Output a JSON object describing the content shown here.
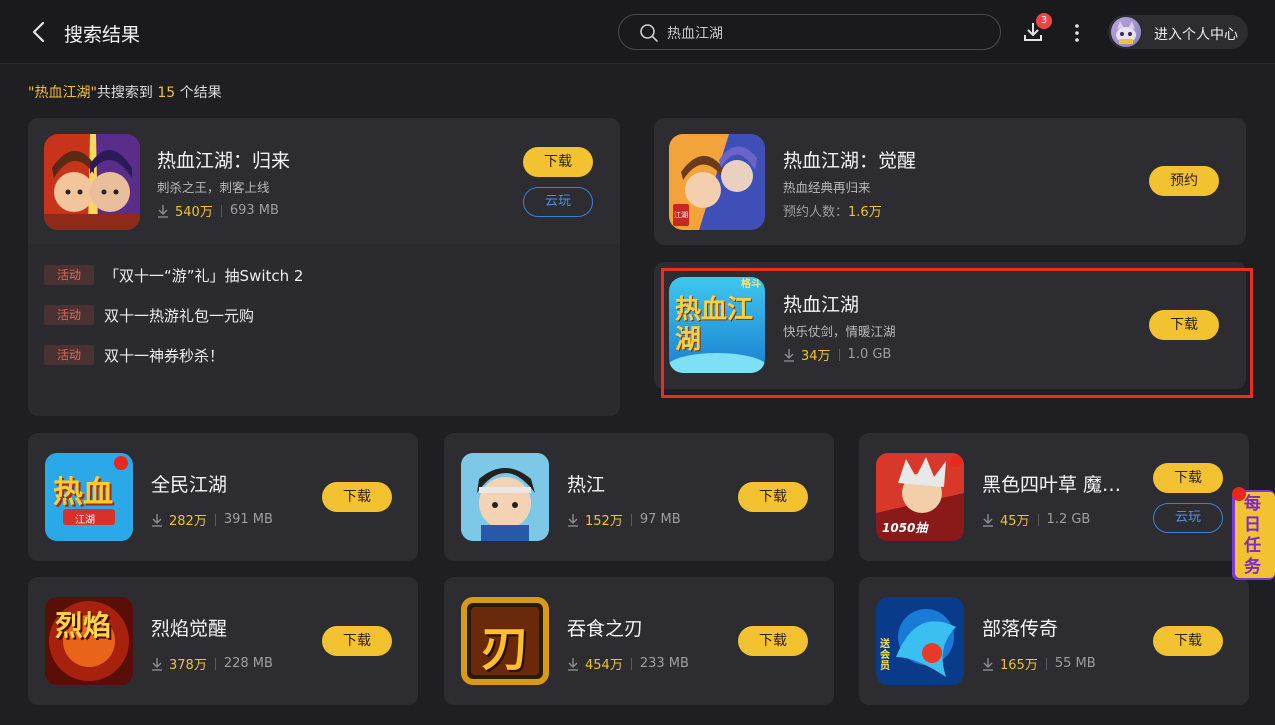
{
  "header": {
    "title": "搜索结果",
    "search_text": "热血江湖",
    "download_badge": "3",
    "profile_label": "进入个人中心"
  },
  "summary": {
    "quote_open": "\"",
    "keyword": "热血江湖",
    "quote_close": "\"",
    "prefix": "共搜索到",
    "count": "15",
    "suffix": "个结果"
  },
  "featured": {
    "name": "热血江湖：归来",
    "desc": "刺杀之王，刺客上线",
    "downloads": "540万",
    "size": "693 MB",
    "download_label": "下载",
    "cloud_label": "云玩",
    "activities": [
      {
        "tag": "活动",
        "text": "「双十一“游”礼」抽Switch 2"
      },
      {
        "tag": "活动",
        "text": "双十一热游礼包一元购"
      },
      {
        "tag": "活动",
        "text": "双十一神券秒杀！"
      }
    ]
  },
  "right_cards": [
    {
      "name": "热血江湖：觉醒",
      "desc": "热血经典再归来",
      "meta_label": "预约人数：",
      "meta_value": "1.6万",
      "button": "预约"
    },
    {
      "name": "热血江湖",
      "desc": "快乐仗剑，情暖江湖",
      "downloads": "34万",
      "size": "1.0 GB",
      "button": "下载"
    }
  ],
  "grid": [
    {
      "name": "全民江湖",
      "downloads": "282万",
      "size": "391 MB",
      "button": "下载"
    },
    {
      "name": "热江",
      "downloads": "152万",
      "size": "97 MB",
      "button": "下载"
    },
    {
      "name": "黑色四叶草 魔…",
      "downloads": "45万",
      "size": "1.2 GB",
      "button": "下载",
      "cloud": "云玩"
    },
    {
      "name": "烈焰觉醒",
      "downloads": "378万",
      "size": "228 MB",
      "button": "下载"
    },
    {
      "name": "吞食之刃",
      "downloads": "454万",
      "size": "233 MB",
      "button": "下载"
    },
    {
      "name": "部落传奇",
      "downloads": "165万",
      "size": "55 MB",
      "button": "下载"
    }
  ],
  "icon_text": {
    "rxjh_main": "热血江湖",
    "rxjh_tag": "格斗",
    "awaken_tag": "江湖",
    "quanmin_big": "热血",
    "quanmin_small": "江湖",
    "clover_label": "1050抽",
    "lieyan": "烈焰",
    "blade": "刃",
    "tribe_tag": "送会员"
  },
  "daily_task": "每日任务",
  "colors": {
    "accent": "#f2c230",
    "cloud_blue": "#3d7fd8",
    "highlight_red": "#e8311c",
    "badge_red": "#f04444"
  }
}
